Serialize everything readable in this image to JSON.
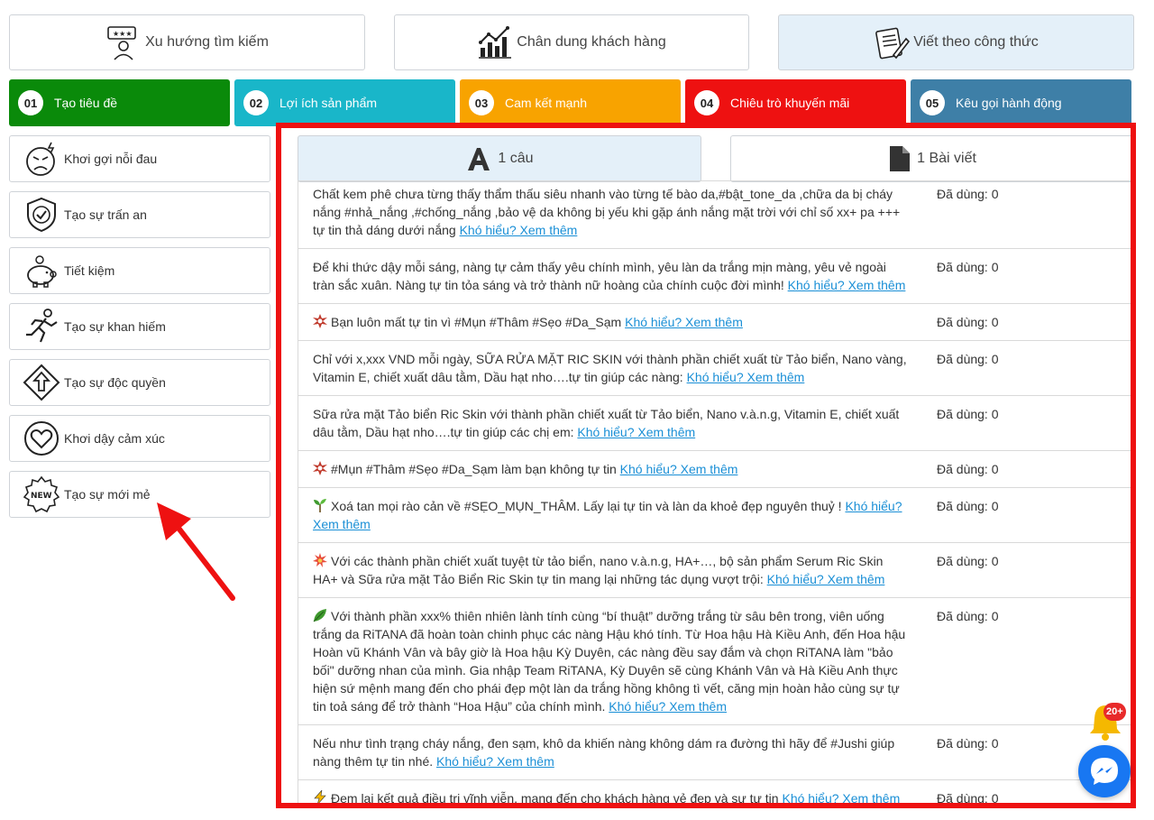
{
  "top_tabs": [
    {
      "label": "Xu hướng tìm kiếm",
      "icon": "search-trend-icon"
    },
    {
      "label": "Chân dung khách hàng",
      "icon": "chart-icon"
    },
    {
      "label": "Viết theo công thức",
      "icon": "notepad-pen-icon"
    }
  ],
  "steps": [
    {
      "num": "01",
      "label": "Tạo tiêu đề",
      "color": "#0a8a0a"
    },
    {
      "num": "02",
      "label": "Lợi ích sản phẩm",
      "color": "#19b6c9"
    },
    {
      "num": "03",
      "label": "Cam kết mạnh",
      "color": "#f8a300"
    },
    {
      "num": "04",
      "label": "Chiêu trò khuyến mãi",
      "color": "#ee1111"
    },
    {
      "num": "05",
      "label": "Kêu gọi hành động",
      "color": "#3e7fa7"
    }
  ],
  "menu": [
    {
      "label": "Khơi gợi nỗi đau",
      "icon": "angry-face-icon"
    },
    {
      "label": "Tạo sự trấn an",
      "icon": "shield-check-icon"
    },
    {
      "label": "Tiết kiệm",
      "icon": "piggy-bank-icon"
    },
    {
      "label": "Tạo sự khan hiếm",
      "icon": "running-man-icon"
    },
    {
      "label": "Tạo sự độc quyền",
      "icon": "arrow-up-sign-icon"
    },
    {
      "label": "Khơi dậy cảm xúc",
      "icon": "heart-icon"
    },
    {
      "label": "Tạo sự mới mẻ",
      "icon": "new-badge-icon"
    }
  ],
  "modes": [
    {
      "label": "1 câu",
      "icon": "letter-a-icon"
    },
    {
      "label": "1 Bài viết",
      "icon": "document-icon"
    }
  ],
  "more_link": "Khó hiểu? Xem thêm",
  "used_label": "Đã dùng: 0",
  "rows": [
    {
      "emoji": "",
      "text": "Chất kem phê chưa từng thấy thẩm thấu siêu nhanh vào từng tế bào da,#bật_tone_da ,chữa da bị cháy nắng #nhả_nắng ,#chống_nắng ,bảo vệ da không bị yếu khi gặp ánh nắng mặt trời với chỉ số xx+ pa +++ tự tin thả dáng dưới nắng"
    },
    {
      "emoji": "",
      "text": "Để khi thức dậy mỗi sáng, nàng tự cảm thấy yêu chính mình, yêu làn da trắng mịn màng, yêu vẻ ngoài tràn sắc xuân. Nàng tự tin tỏa sáng và trở thành nữ hoàng của chính cuộc đời mình!"
    },
    {
      "emoji": "burst",
      "text": "Bạn luôn mất tự tin vì #Mụn #Thâm #Sẹo #Da_Sạm"
    },
    {
      "emoji": "",
      "text": "Chỉ với x,xxx VND mỗi ngày, SỮA RỬA MẶT RIC SKIN với thành phần chiết xuất từ Tảo biển, Nano vàng, Vitamin E, chiết xuất dâu tằm, Dầu hạt nho….tự tin giúp các nàng:"
    },
    {
      "emoji": "",
      "text": "Sữa rửa mặt Tảo biển Ric Skin với thành phần chiết xuất từ Tảo biển, Nano v.à.n.g, Vitamin E, chiết xuất dâu tằm, Dầu hạt nho….tự tin giúp các chị em:"
    },
    {
      "emoji": "burst",
      "text": "#Mụn #Thâm #Sẹo #Da_Sạm làm bạn không tự tin"
    },
    {
      "emoji": "sprout",
      "text": "Xoá tan mọi rào cản về #SẸO_MỤN_THÂM. Lấy lại tự tin và làn da khoẻ đẹp nguyên thuỷ !"
    },
    {
      "emoji": "collision",
      "text": "Với các thành phần chiết xuất tuyệt từ tảo biển, nano v.à.n.g, HA+…, bộ sản phẩm Serum Ric Skin HA+ và Sữa rửa mặt Tảo Biển Ric Skin tự tin mang lại những tác dụng vượt trội:"
    },
    {
      "emoji": "leaf",
      "text": "Với thành phần xxx% thiên nhiên lành tính cùng “bí thuật” dưỡng trắng từ sâu bên trong, viên uống trắng da RiTANA đã hoàn toàn chinh phục các nàng Hậu khó tính. Từ Hoa hậu Hà Kiều Anh, đến Hoa hậu Hoàn vũ Khánh Vân và bây giờ là Hoa hậu Kỳ Duyên, các nàng đều say đắm và chọn RiTANA làm \"bảo bối\" dưỡng nhan của mình. Gia nhập Team RiTANA, Kỳ Duyên sẽ cùng Khánh Vân và Hà Kiều Anh thực hiện sứ mệnh mang đến cho phái đẹp một làn da trắng hồng không tì vết, căng mịn hoàn hảo cùng sự tự tin toả sáng để trở thành “Hoa Hậu” của chính mình."
    },
    {
      "emoji": "",
      "text": "Nếu như tình trạng cháy nắng, đen sạm, khô da khiến nàng không dám ra đường thì hãy để #Jushi giúp nàng thêm tự tin nhé."
    },
    {
      "emoji": "zap",
      "text": "Đem lại kết quả điều trị vĩnh viễn, mang đến cho khách hàng vẻ đẹp và sự tự tin"
    }
  ],
  "notification_badge": "20+"
}
